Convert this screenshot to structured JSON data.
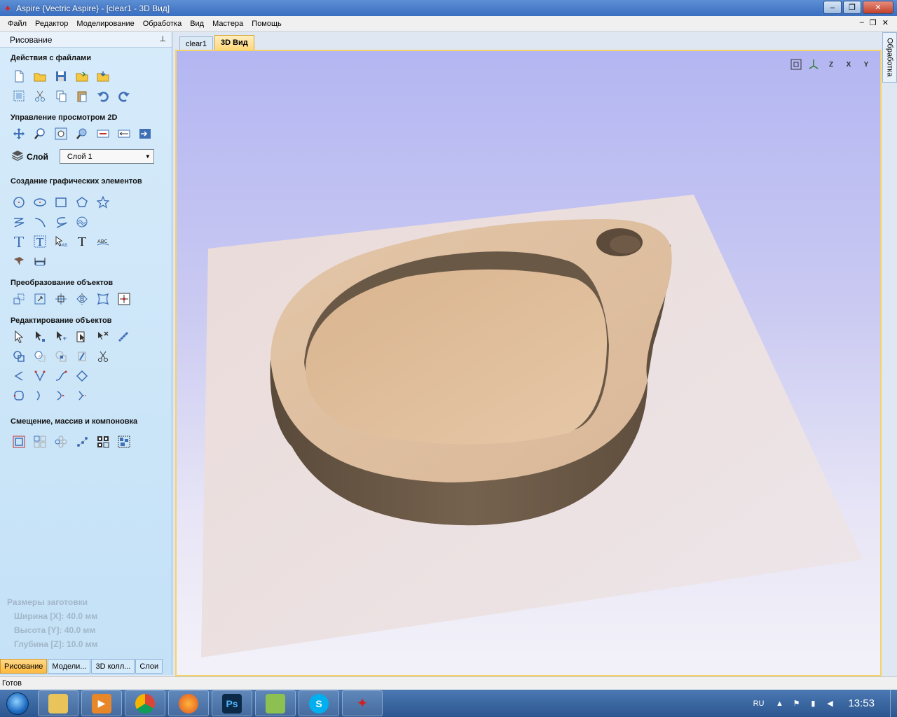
{
  "window": {
    "title": "Aspire {Vectric Aspire} - [clear1 - 3D Вид]",
    "buttons": {
      "minimize": "–",
      "maximize": "❐",
      "close": "✕"
    }
  },
  "menu": [
    "Файл",
    "Редактор",
    "Моделирование",
    "Обработка",
    "Вид",
    "Мастера",
    "Помощь"
  ],
  "mdi_buttons": [
    "–",
    "❐",
    "✕"
  ],
  "left_panel": {
    "title": "Рисование",
    "sections": {
      "file_actions": "Действия с файлами",
      "view_2d": "Управление просмотром 2D",
      "create": "Создание графических элементов",
      "transform": "Преобразование объектов",
      "edit": "Редактирование объектов",
      "offset": "Смещение, массив и компоновка"
    },
    "layer": {
      "label": "Слой",
      "value": "Слой 1"
    },
    "stock": {
      "title": "Размеры заготовки",
      "width": "Ширина  [X]: 40.0 мм",
      "height": "Высота  [Y]: 40.0 мм",
      "depth": "Глубина [Z]: 10.0 мм"
    },
    "bottom_tabs": [
      "Рисование",
      "Модели...",
      "3D колл...",
      "Слои"
    ]
  },
  "doc_tabs": [
    "clear1",
    "3D Вид"
  ],
  "right_tab": "Обработка",
  "view_tools": [
    "fit-view",
    "iso-view",
    "z-view",
    "x-view",
    "y-view"
  ],
  "view_tool_labels": [
    "",
    "",
    "Z",
    "X",
    "Y"
  ],
  "status": "Готов",
  "taskbar": {
    "apps": [
      "explorer",
      "media-player",
      "chrome",
      "firefox",
      "photoshop",
      "notepad",
      "skype",
      "aspire"
    ],
    "lang": "RU",
    "time": "13:53"
  },
  "colors": {
    "titlebar": "#3a6ec0",
    "active_tab": "#ffd87a",
    "wood_top": "#e1c3a4",
    "wood_wall": "#6f5c48"
  }
}
